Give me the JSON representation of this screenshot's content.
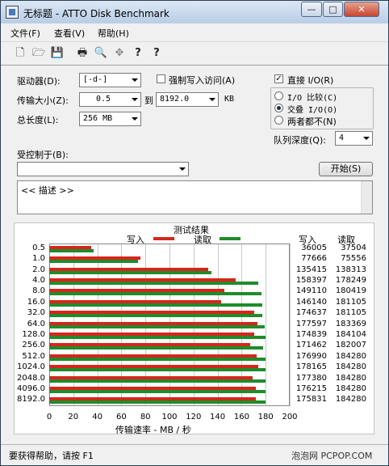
{
  "window": {
    "title": "无标题 - ATTO Disk Benchmark",
    "minimize": "—",
    "maximize": "□",
    "close": "✕"
  },
  "menu": [
    "文件(F)",
    "查看(V)",
    "帮助(H)"
  ],
  "toolbar": {
    "icons": [
      "new-file-icon",
      "open-folder-icon",
      "save-icon",
      "print-icon",
      "print-preview-icon",
      "move-icon",
      "help-icon",
      "context-help-icon"
    ],
    "glyphs": [
      "🗋",
      "🗁",
      "💾",
      "🖶",
      "🔍",
      "✥",
      "?",
      "?"
    ]
  },
  "settings": {
    "drive_label": "驱动器(D):",
    "drive_value": "[-d-]",
    "force_write_label": "强制写入访问(A)",
    "force_write_checked": false,
    "direct_io_label": "直接 I/O(R)",
    "direct_io_checked": true,
    "transfer_label": "传输大小(Z):",
    "transfer_from": "0.5",
    "transfer_to_label": "到",
    "transfer_to": "8192.0",
    "transfer_unit": "KB",
    "length_label": "总长度(L):",
    "length_value": "256 MB",
    "io_mode_options": [
      "I/O 比较(C)",
      "交叠 I/O(O)",
      "两者都不(N)"
    ],
    "io_mode_selected": 1,
    "queue_label": "队列深度(Q):",
    "queue_value": "4",
    "controlled_label": "受控制于(B):",
    "controlled_value": "",
    "start_button": "开始(S)",
    "description": "<< 描述 >>"
  },
  "results": {
    "title": "测试结果",
    "legend_write": "写入",
    "legend_read": "读取",
    "col_write": "写入",
    "col_read": "读取",
    "xlabel": "传输速率 - MB / 秒",
    "colors": {
      "write": "#d6261c",
      "read": "#1f8c2a"
    }
  },
  "chart_data": {
    "type": "bar",
    "orientation": "horizontal",
    "title": "测试结果",
    "xlabel": "传输速率 - MB / 秒",
    "xlim": [
      0,
      200
    ],
    "xticks": [
      0,
      20,
      40,
      60,
      80,
      100,
      120,
      140,
      160,
      180,
      200
    ],
    "categories": [
      "0.5",
      "1.0",
      "2.0",
      "4.0",
      "8.0",
      "16.0",
      "32.0",
      "64.0",
      "128.0",
      "256.0",
      "512.0",
      "1024.0",
      "2048.0",
      "4096.0",
      "8192.0"
    ],
    "series": [
      {
        "name": "写入",
        "values": [
          35.2,
          75.8,
          132.3,
          154.7,
          145.6,
          142.7,
          170.5,
          173.4,
          170.7,
          167.4,
          172.8,
          174.0,
          169.3,
          172.1,
          171.7
        ],
        "labels": [
          "36005",
          "77666",
          "135415",
          "158397",
          "149110",
          "146140",
          "174637",
          "177597",
          "174839",
          "171462",
          "176990",
          "178165",
          "177380",
          "176215",
          "175831"
        ]
      },
      {
        "name": "读取",
        "values": [
          36.6,
          73.8,
          135.1,
          174.1,
          176.2,
          176.9,
          176.9,
          179.1,
          179.8,
          177.9,
          180.0,
          180.0,
          180.0,
          180.0,
          180.0
        ],
        "labels": [
          "37504",
          "75556",
          "138313",
          "178249",
          "180419",
          "181105",
          "181105",
          "183369",
          "184104",
          "182007",
          "184280",
          "184280",
          "184280",
          "184280",
          "184280"
        ]
      }
    ]
  },
  "status": {
    "help": "要获得帮助，请按 F1",
    "watermark": "泡泡网 PCPOP.COM"
  }
}
